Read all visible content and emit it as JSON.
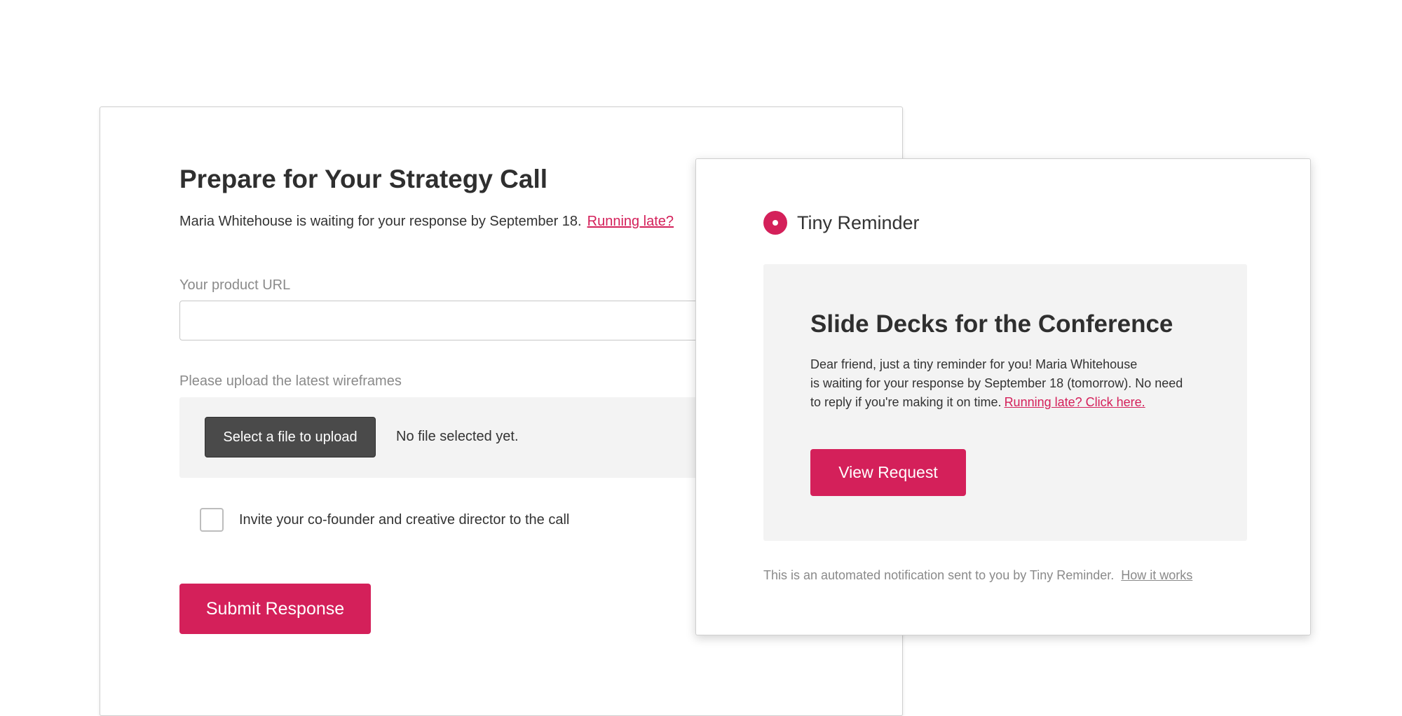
{
  "colors": {
    "accent": "#d4205a",
    "dark_button": "#4a4a4a",
    "panel_background": "#f3f3f3",
    "muted_text": "#8a8a8a"
  },
  "form": {
    "title": "Prepare for Your Strategy Call",
    "subtitle": "Maria Whitehouse is waiting for your response by September 18.",
    "running_late_link": "Running late?",
    "product_url_label": "Your product URL",
    "product_url_value": "",
    "upload_label": "Please upload the latest wireframes",
    "select_file_button": "Select a file to upload",
    "no_file_text": "No file selected yet.",
    "invite_checked": false,
    "invite_label": "Invite your co-founder and creative director to the call",
    "submit_button": "Submit Response"
  },
  "email": {
    "brand_icon": "tiny-reminder-logo-icon",
    "brand_name": "Tiny Reminder",
    "title": "Slide Decks for the Conference",
    "body_line_1": "Dear friend, just a tiny reminder for you! Maria Whitehouse",
    "body_line_2": "is waiting for your response by September 18 (tomorrow). No need",
    "body_line_3": "to reply if you're making it on time.",
    "body_link": "Running late? Click here.",
    "view_button": "View Request",
    "footer_text": "This is an automated notification sent to you by Tiny Reminder.",
    "footer_link": "How it works"
  }
}
